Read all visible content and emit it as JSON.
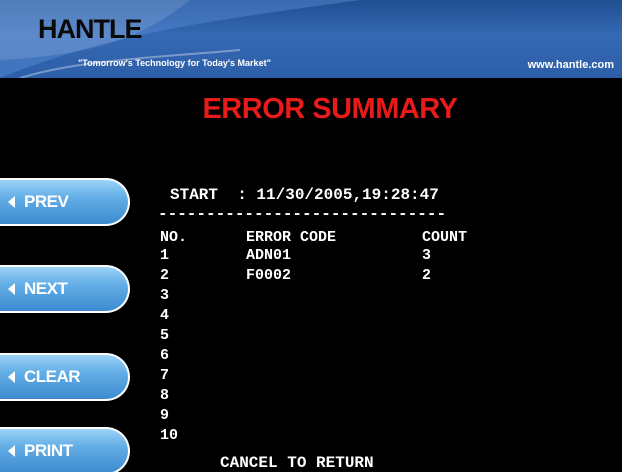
{
  "header": {
    "logo": "HANTLE",
    "tagline": "\"Tomorrow's Technology for Today's Market\"",
    "website": "www.hantle.com"
  },
  "title": "ERROR SUMMARY",
  "buttons": {
    "prev": "PREV",
    "next": "NEXT",
    "clear": "CLEAR",
    "print": "PRINT"
  },
  "report": {
    "start_label": "START",
    "start_value": "11/30/2005,19:28:47",
    "divider": "------------------------------",
    "columns": {
      "no": "NO.",
      "code": "ERROR CODE",
      "count": "COUNT"
    },
    "rows": [
      {
        "no": "1",
        "code": "ADN01",
        "count": "3"
      },
      {
        "no": "2",
        "code": "F0002",
        "count": "2"
      },
      {
        "no": "3",
        "code": "",
        "count": ""
      },
      {
        "no": "4",
        "code": "",
        "count": ""
      },
      {
        "no": "5",
        "code": "",
        "count": ""
      },
      {
        "no": "6",
        "code": "",
        "count": ""
      },
      {
        "no": "7",
        "code": "",
        "count": ""
      },
      {
        "no": "8",
        "code": "",
        "count": ""
      },
      {
        "no": "9",
        "code": "",
        "count": ""
      },
      {
        "no": "10",
        "code": "",
        "count": ""
      }
    ]
  },
  "footer": "CANCEL TO RETURN",
  "colors": {
    "title": "#e81a1a",
    "button": "#63aee6",
    "header": "#3669b3"
  }
}
